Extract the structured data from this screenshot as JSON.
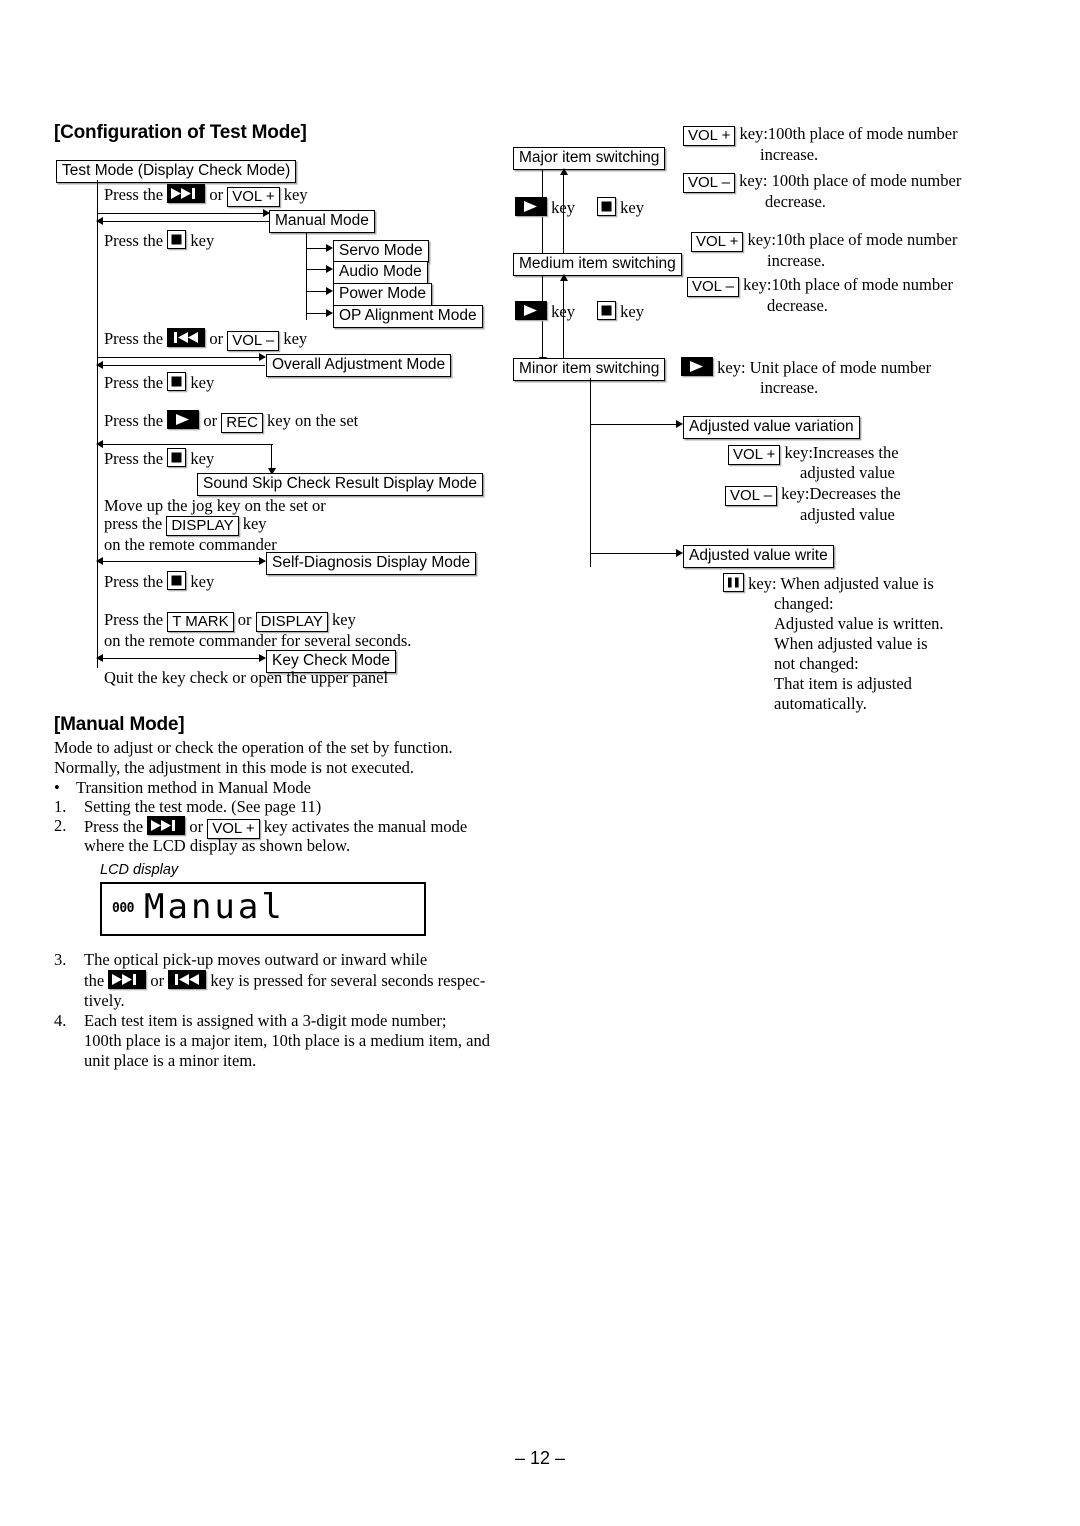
{
  "page": {
    "number": "– 12 –"
  },
  "sections": {
    "config_heading": "[Configuration of Test Mode]",
    "manual_heading": "[Manual Mode]"
  },
  "left_flow": {
    "boxes": {
      "test_mode": "Test Mode (Display Check Mode)",
      "manual_mode": "Manual Mode",
      "servo_mode": "Servo Mode",
      "audio_mode": "Audio Mode",
      "power_mode": "Power Mode",
      "op_alignment_mode": "OP Alignment Mode",
      "overall_adjustment_mode": "Overall Adjustment Mode",
      "sound_skip": "Sound Skip Check Result  Display Mode",
      "self_diagnosis": "Self-Diagnosis Display Mode",
      "key_check": "Key Check Mode"
    },
    "steps": {
      "s1_pre": "Press the",
      "s1_or": "or",
      "s1_key_ffwd": "ffwd-key-icon",
      "s1_key_volplus": "VOL +",
      "s1_post": "key",
      "s2_pre": "Press the",
      "s2_key_stop": "stop-key-icon",
      "s2_post": "key",
      "s3_pre": "Press the",
      "s3_or": "or",
      "s3_key_rew": "rew-key-icon",
      "s3_key_volminus": "VOL –",
      "s3_post": "key",
      "s4_pre": "Press the",
      "s4_key_stop": "stop-key-icon",
      "s4_post": "key",
      "s5_pre": "Press the",
      "s5_or": "or",
      "s5_key_play": "play-key-icon",
      "s5_key_rec": "REC",
      "s5_post": "key on the set",
      "s6_pre": "Press the",
      "s6_key_stop": "stop-key-icon",
      "s6_post": "key",
      "s7_line1": "Move up the jog key on the set or",
      "s7_line2_pre": "press the",
      "s7_key_display": "DISPLAY",
      "s7_line2_post": "key",
      "s7_line3": "on the remote commander",
      "s8_pre": "Press the",
      "s8_key_stop": "stop-key-icon",
      "s8_post": "key",
      "s9_pre": "Press the",
      "s9_key_tmark": "T MARK",
      "s9_or": "or",
      "s9_key_display": "DISPLAY",
      "s9_post": "key",
      "s9_line2": "on the remote commander for several seconds.",
      "s10": "Quit the key check or open the upper panel"
    }
  },
  "right_flow": {
    "boxes": {
      "major": "Major item switching",
      "medium": "Medium item switching",
      "minor": "Minor item switching",
      "adj_variation": "Adjusted value variation",
      "adj_write": "Adjusted value write"
    },
    "transition_labels": {
      "down1_key": "play-key-icon",
      "down1_text": "key",
      "up1_key": "stop-key-icon",
      "up1_text": "key",
      "down2_key": "play-key-icon",
      "down2_text": "key",
      "up2_key": "stop-key-icon",
      "up2_text": "key"
    },
    "notes": {
      "major_inc_key": "VOL +",
      "major_inc_l1": "key:100th place of mode number",
      "major_inc_l2": "increase.",
      "major_dec_key": "VOL –",
      "major_dec_l1": "key: 100th place of mode number",
      "major_dec_l2": "decrease.",
      "medium_inc_key": "VOL +",
      "medium_inc_l1": "key:10th place of mode number",
      "medium_inc_l2": "increase.",
      "medium_dec_key": "VOL –",
      "medium_dec_l1": "key:10th place of mode number",
      "medium_dec_l2": "decrease.",
      "minor_key": "play-key-icon",
      "minor_l1": "key: Unit place of mode number",
      "minor_l2": "increase.",
      "var_inc_key": "VOL +",
      "var_inc_l1": "key:Increases the",
      "var_inc_l2": "adjusted value",
      "var_dec_key": "VOL –",
      "var_dec_l1": "key:Decreases the",
      "var_dec_l2": "adjusted value",
      "write_key": "pause-key-icon",
      "write_l1": "key: When adjusted value is",
      "write_l2": "changed:",
      "write_l3": "Adjusted value is written.",
      "write_l4": "When adjusted value is",
      "write_l5": "not changed:",
      "write_l6": "That item is adjusted",
      "write_l7": "automatically."
    }
  },
  "manual_mode": {
    "intro_l1": "Mode to adjust or check the operation of the set by function.",
    "intro_l2": "Normally, the adjustment in this mode is not executed.",
    "bullet": "Transition method in Manual Mode",
    "bullet_marker": "•",
    "item1_num": "1.",
    "item1_text": "Setting the test mode. (See page 11)",
    "item2_num": "2.",
    "item2_pre": "Press the",
    "item2_or": "or",
    "item2_key_ffwd": "ffwd-key-icon",
    "item2_key_volplus": "VOL +",
    "item2_post": "key activates the manual mode",
    "item2_line2": "where the LCD display as shown below.",
    "item3_num": "3.",
    "item3_l1": "The  optical  pick-up  moves  outward  or  inward  while",
    "item3_l2_pre": "the",
    "item3_l2_or": "or",
    "item3_key_ffwd": "ffwd-key-icon",
    "item3_key_rew": "rew-key-icon",
    "item3_l2_post": "key is pressed for several seconds respec-",
    "item3_l3": "tively.",
    "item4_num": "4.",
    "item4_l1": "Each test item is assigned with a 3-digit mode number;",
    "item4_l2": "100th place is a major item, 10th place is a medium item, and",
    "item4_l3": "unit place is a minor item."
  },
  "lcd": {
    "label": "LCD display",
    "digits": "000",
    "text": "Manual"
  },
  "colors": {
    "ink": "#000000",
    "paper": "#ffffff",
    "box_shadow": "#a8a8a8"
  }
}
